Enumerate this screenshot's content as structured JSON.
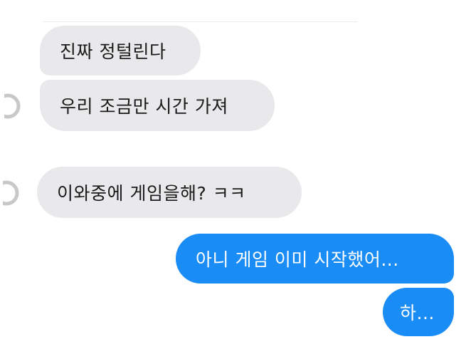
{
  "messages": [
    {
      "direction": "incoming",
      "text": "진짜 정털린다"
    },
    {
      "direction": "incoming",
      "text": "우리 조금만 시간 가져"
    },
    {
      "direction": "incoming",
      "text": "이와중에 게임을해? ㅋㅋ"
    },
    {
      "direction": "outgoing",
      "text": "아니 게임 이미 시작했어..."
    },
    {
      "direction": "outgoing",
      "text": "하..."
    }
  ],
  "colors": {
    "incoming_bubble": "#e9e9eb",
    "outgoing_bubble": "#1a8cf5",
    "incoming_text": "#1a1a1a",
    "outgoing_text": "#ffffff"
  },
  "icons": {
    "avatar": "avatar-icon"
  }
}
